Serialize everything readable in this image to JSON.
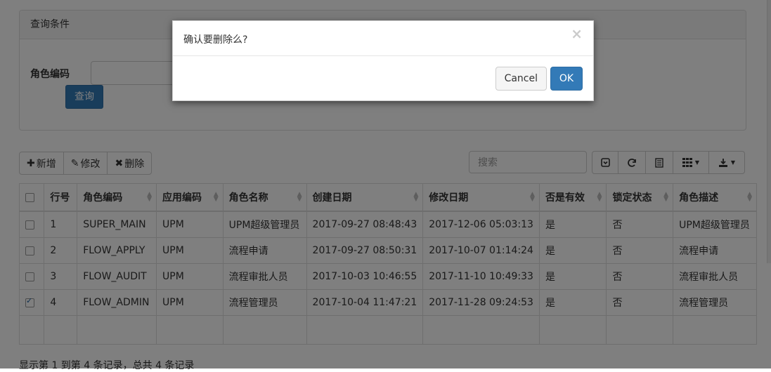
{
  "query_panel": {
    "title": "查询条件",
    "role_code_label": "角色编码",
    "role_code_value": "",
    "query_button": "查询"
  },
  "toolbar": {
    "add": "新增",
    "edit": "修改",
    "delete": "删除",
    "search_placeholder": "搜索",
    "right_icons": [
      "toggle-icon",
      "refresh-icon",
      "list-icon",
      "columns-icon",
      "export-icon"
    ]
  },
  "table": {
    "headers": [
      "行号",
      "角色编码",
      "应用编码",
      "角色名称",
      "创建日期",
      "修改日期",
      "否是有效",
      "锁定状态",
      "角色描述"
    ],
    "rows": [
      {
        "checked": false,
        "no": "1",
        "code": "SUPER_MAIN",
        "app": "UPM",
        "name": "UPM超级管理员",
        "created": "2017-09-27 08:48:43",
        "modified": "2017-12-06 05:03:13",
        "valid": "是",
        "locked": "否",
        "desc": "UPM超级管理员"
      },
      {
        "checked": false,
        "no": "2",
        "code": "FLOW_APPLY",
        "app": "UPM",
        "name": "流程申请",
        "created": "2017-09-27 08:50:31",
        "modified": "2017-10-07 01:14:24",
        "valid": "是",
        "locked": "否",
        "desc": "流程申请"
      },
      {
        "checked": false,
        "no": "3",
        "code": "FLOW_AUDIT",
        "app": "UPM",
        "name": "流程审批人员",
        "created": "2017-10-03 10:46:55",
        "modified": "2017-11-10 10:49:33",
        "valid": "是",
        "locked": "否",
        "desc": "流程审批人员"
      },
      {
        "checked": true,
        "no": "4",
        "code": "FLOW_ADMIN",
        "app": "UPM",
        "name": "流程管理员",
        "created": "2017-10-04 11:47:21",
        "modified": "2017-11-28 09:24:53",
        "valid": "是",
        "locked": "否",
        "desc": "流程管理员"
      }
    ],
    "footer": "显示第 1 到第 4 条记录，总共 4 条记录"
  },
  "modal": {
    "title": "确认要删除么?",
    "close": "×",
    "cancel": "Cancel",
    "ok": "OK"
  }
}
